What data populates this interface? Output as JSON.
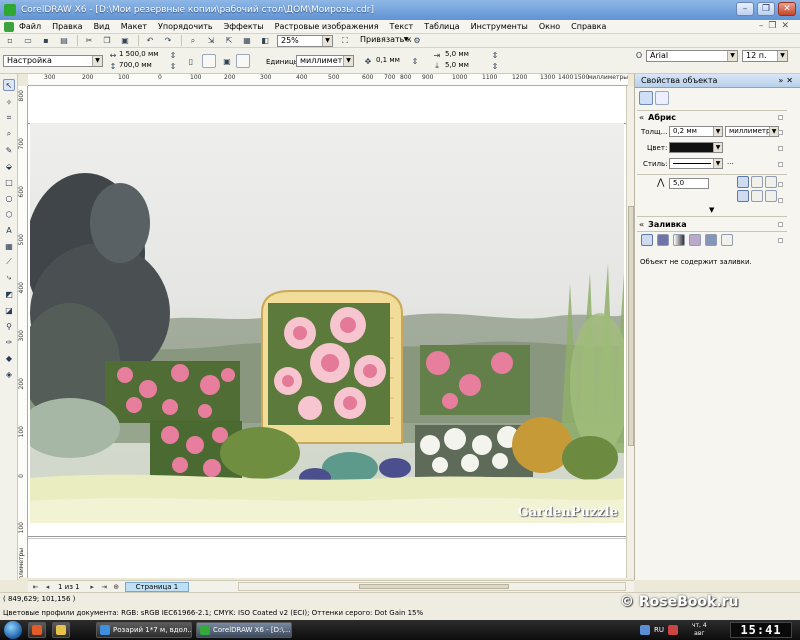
{
  "window": {
    "title": "CorelDRAW X6 - [D:\\Мои резервные копии\\рабочий стол\\ДОМ\\Моирозы.cdr]"
  },
  "menu": {
    "items": [
      "Файл",
      "Правка",
      "Вид",
      "Макет",
      "Упорядочить",
      "Эффекты",
      "Растровые изображения",
      "Текст",
      "Таблица",
      "Инструменты",
      "Окно",
      "Справка"
    ]
  },
  "toolbar": {
    "zoom": "25%",
    "snap_label": "Привязать к"
  },
  "property_bar": {
    "preset": "Настройка",
    "width": "1 500,0 мм",
    "height": "700,0 мм",
    "units_label": "Единицы:",
    "units_value": "миллиметры",
    "nudge": "0,1 мм",
    "dup_x": "5,0 мм",
    "dup_y": "5,0 мм",
    "font_name": "Arial",
    "font_size": "12 п."
  },
  "ruler": {
    "top_ticks": [
      "300",
      "200",
      "100",
      "0",
      "100",
      "200",
      "300",
      "400",
      "500",
      "600",
      "700",
      "800",
      "900",
      "1000",
      "1100",
      "1200",
      "1300",
      "1400",
      "1500"
    ],
    "unit": "миллиметры",
    "left_ticks": [
      "800",
      "700",
      "600",
      "500",
      "400",
      "300",
      "200",
      "100",
      "0",
      "100"
    ]
  },
  "artwork": {
    "watermark": "GardenPuzzle"
  },
  "page_nav": {
    "count": "1 из 1",
    "page_tab": "Страница 1"
  },
  "status": {
    "coords": "( 849,629; 101,156 )",
    "profile": "Цветовые профили документа: RGB: sRGB IEC61966-2.1; CMYK: ISO Coated v2 (ECI); Оттенки серого: Dot Gain 15%"
  },
  "site_watermark": "© RoseBook.ru",
  "docker": {
    "title": "Свойства объекта",
    "outline_title": "Абрис",
    "thickness_label": "Толщ...",
    "thickness_value": "0,2 мм",
    "thickness_unit": "миллиметры",
    "color_label": "Цвет:",
    "style_label": "Стиль:",
    "style_more": "...",
    "miter_value": "5,0",
    "fill_title": "Заливка",
    "no_fill_text": "Объект не содержит заливки."
  },
  "taskbar": {
    "tasks": [
      "Розарий 1*7 м, вдол...",
      "CorelDRAW X6 - [D:\\..."
    ],
    "lang": "RU",
    "date_line1": "чт, 4",
    "date_line2": "авг",
    "time": "15:41"
  }
}
